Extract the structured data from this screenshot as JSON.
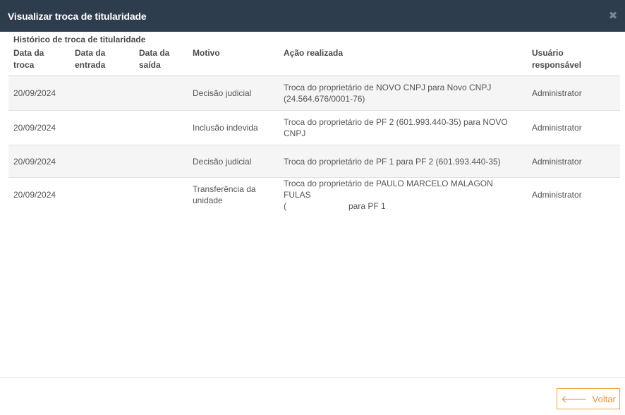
{
  "modal": {
    "title": "Visualizar troca de titularidade",
    "close_icon": "close-icon"
  },
  "section": {
    "title": "Histórico de troca de titularidade"
  },
  "table": {
    "headers": {
      "data_troca": [
        "Data da",
        "troca"
      ],
      "data_entrada": [
        "Data da",
        "entrada"
      ],
      "data_saida": [
        "Data da",
        "saída"
      ],
      "motivo": "Motivo",
      "acao": "Ação realizada",
      "usuario": [
        "Usuário",
        "responsável"
      ]
    },
    "rows": [
      {
        "data_troca": "20/09/2024",
        "data_entrada": "",
        "data_saida": "",
        "motivo": "Decisão judicial",
        "acao": "Troca do proprietário de NOVO CNPJ para Novo CNPJ (24.564.676/0001-76)",
        "usuario": "Administrator"
      },
      {
        "data_troca": "20/09/2024",
        "data_entrada": "",
        "data_saida": "",
        "motivo": "Inclusão indevida",
        "acao": "Troca do proprietário de PF 2 (601.993.440-35) para NOVO CNPJ",
        "usuario": "Administrator"
      },
      {
        "data_troca": "20/09/2024",
        "data_entrada": "",
        "data_saida": "",
        "motivo": "Decisão judicial",
        "acao": "Troca do proprietário de PF 1 para PF 2 (601.993.440-35)",
        "usuario": "Administrator"
      },
      {
        "data_troca": "20/09/2024",
        "data_entrada": "",
        "data_saida": "",
        "motivo": "Transferência da unidade",
        "acao_line1": "Troca do proprietário de PAULO MARCELO MALAGON FULAS",
        "acao_line2_start": "(",
        "acao_line2_end": "para PF 1",
        "usuario": "Administrator"
      }
    ]
  },
  "footer": {
    "back_label": "Voltar",
    "back_icon": "arrow-left-icon",
    "accent_color": "#e8923a"
  }
}
